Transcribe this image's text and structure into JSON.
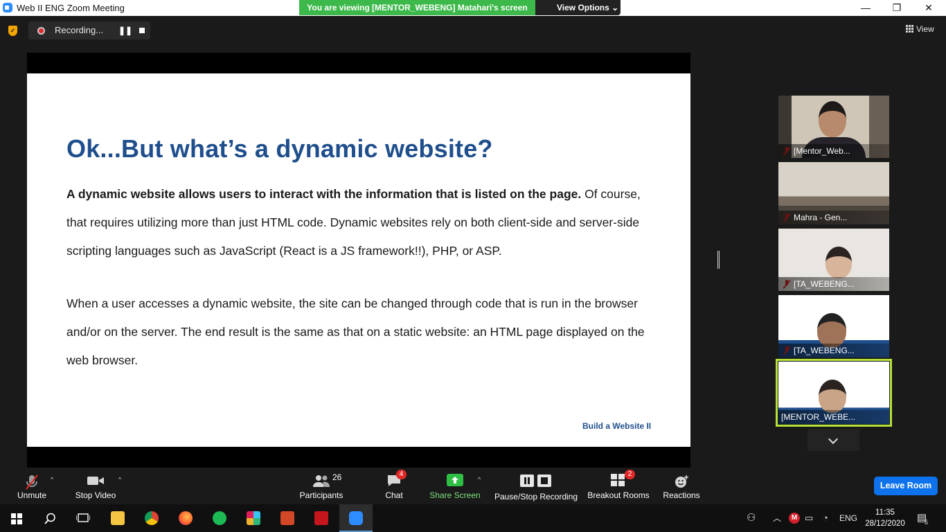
{
  "window": {
    "title": "Web II ENG   Zoom Meeting",
    "controls": {
      "minimize": "—",
      "maximize": "❐",
      "close": "✕"
    }
  },
  "banner": {
    "viewing_text": "You are viewing [MENTOR_WEBENG] Matahari's screen",
    "view_options_label": "View Options ⌄"
  },
  "topbar": {
    "recording_label": "Recording...",
    "pause_symbol": "❚❚",
    "view_label": "View"
  },
  "slide": {
    "title": "Ok...But what’s a dynamic website?",
    "para1_bold": "A dynamic website allows users to interact with the information that is listed on the page.",
    "para1_rest": " Of course, that requires utilizing more than just HTML code. Dynamic websites rely on both client-side and server-side scripting languages such as JavaScript (React is a JS framework!!), PHP,  or ASP.",
    "para2": "When a user accesses a dynamic website, the site can be changed through code that is run in the browser and/or on the server. The end result is the same as that on a static website: an HTML page displayed on the web browser.",
    "footer": "Build a Website II"
  },
  "participants_panel": {
    "tiles": [
      {
        "name": "[Mentor_Web..."
      },
      {
        "name": "Mahra - Gen..."
      },
      {
        "name": "[TA_WEBENG..."
      },
      {
        "name": "[TA_WEBENG..."
      },
      {
        "name": "[MENTOR_WEBE..."
      }
    ]
  },
  "toolbar": {
    "unmute": "Unmute",
    "stop_video": "Stop Video",
    "participants": "Participants",
    "participants_count": "26",
    "chat": "Chat",
    "chat_badge": "4",
    "share_screen": "Share Screen",
    "pause_stop_recording": "Pause/Stop Recording",
    "breakout_rooms": "Breakout Rooms",
    "breakout_badge": "2",
    "reactions": "Reactions",
    "leave_room": "Leave Room",
    "caret": "^"
  },
  "taskbar": {
    "language": "ENG",
    "time": "11:35",
    "date": "28/12/2020",
    "notifications": "5"
  },
  "colors": {
    "accent_blue": "#1f4e8c",
    "banner_green": "#3cb94a",
    "leave_blue": "#0e72ed",
    "badge_red": "#e02828",
    "active_speaker": "#b6e23a"
  }
}
